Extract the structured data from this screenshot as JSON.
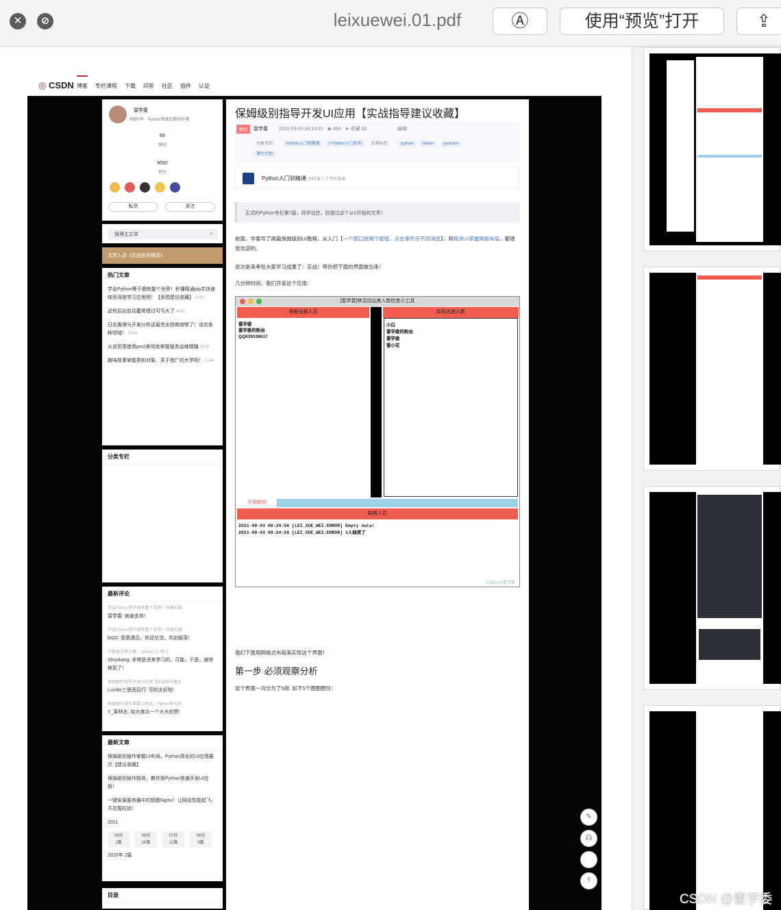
{
  "window": {
    "filename": "leixuewei.01.pdf",
    "open_with_preview": "使用“预览”打开",
    "markup_icon": "pen-circle-icon",
    "share_icon": "share-icon"
  },
  "csdn": {
    "logo": "CSDN",
    "nav": [
      "博客",
      "专栏课程",
      "下载",
      "问答",
      "社区",
      "插件",
      "认证"
    ]
  },
  "profile": {
    "name": "雷学委",
    "level": "码龄0年",
    "tag": "Python领域优质创作者",
    "stat1_value": "69",
    "stat1_label": "原创",
    "stat2_value": "9592",
    "stat2_label": "积分",
    "btn_msg": "私信",
    "btn_follow": "关注"
  },
  "search": {
    "placeholder": "搜博主文章"
  },
  "banner": {
    "text": "文章入选《实战指导推荐》"
  },
  "hot": {
    "title": "热门文章",
    "items": [
      {
        "text": "学会Python等于拥有整个世界！秒懂精通pip并快速体验深度学习应用吧！【多图建议收藏】",
        "views": "4781"
      },
      {
        "text": "这些后台启动蓄势错过可亏大了",
        "views": "4061"
      },
      {
        "text": "日志推理与开发分析这篇完全指南就够了！适应各种领域！",
        "views": "3294"
      },
      {
        "text": "从该到落使用pm2来彻底掌握服务运维精髓",
        "views": "3078"
      },
      {
        "text": "趣味故事掌握类和对象，关于我广的大学网！",
        "views": "2144"
      }
    ]
  },
  "categories": {
    "title": "分类专栏"
  },
  "comments": {
    "title": "最新评论",
    "items": [
      {
        "ref": "学会Python等于拥有整个世界！快速优雅",
        "text": "雷学委: 谢谢支持！"
      },
      {
        "ref": "学会Python等于拥有整个世界！快速优雅",
        "text": "bit22: 感恩遇见，欢迎交流，共创部落！"
      },
      {
        "ref": "大数据王者之路：Ambari 01 简介",
        "text": "Shuokang: 非常是进来学习的，可能，干是，被惊艳到了！"
      },
      {
        "ref": "保姆级别指导开发UI应用【实战指导建议",
        "text": "Lucifer三思而后行: 写的太好啦!"
      },
      {
        "ref": "保姆级别操作掌握UI布局，Python简化的",
        "text": "Y_蒋林志: 给大佬点一个大大的赞!"
      }
    ]
  },
  "latest": {
    "title": "最新文章",
    "items": [
      "保姆级别操作掌握UI布局，Python简化的UI应用展示【建议收藏】",
      "保姆级别操作指导，教你用Python快速开发UI应用！",
      "一键安装服务器中的超跑Nginx！让网站性能起飞，不花冤枉钱！"
    ],
    "year1": "2021",
    "months": [
      {
        "m": "09月",
        "c": "2篇"
      },
      {
        "m": "08月",
        "c": "16篇"
      },
      {
        "m": "07月",
        "c": "12篇"
      },
      {
        "m": "06月",
        "c": "9篇"
      }
    ],
    "year2": "2020年  2篇"
  },
  "toc": {
    "title": "目录"
  },
  "article": {
    "title": "保姆级别指导开发UI应用【实战指导建议收藏】",
    "badge": "原创",
    "author": "雷学委",
    "date": "2021-09-03 04:14:31",
    "views": "464",
    "collect": "收藏 62",
    "edit": "编辑",
    "column_label": "分类专栏：",
    "column1": "Python入门到精通",
    "column2": "# Python入门系列",
    "tags_label": "文章标签：",
    "tags": [
      "python",
      "tkinter",
      "pycharm"
    ],
    "plan": "潜力计划",
    "col_name": "Python入门到精通",
    "col_sub": "同时被 2 个专栏收录",
    "quote": "正式的Python专栏第7篇，同学站住，别错过这个从0开始的文章！",
    "p1_a": "前面，学委写了两篇保姆级别UI教程，从入门【",
    "p1_link1": "一个窗口放两个按钮，点击事件示不同消息",
    "p1_b": "】，到",
    "p1_link2": "精讲UI掌握网格布局",
    "p1_c": "，都很受欢迎的。",
    "p2": "这次是来考验大家学习成果了：实战！带你把下面的界面做出来！",
    "p3": "几分钟时间，我们开发这个应用：",
    "p4": "我们下面用网格式布局来实现这个界面！",
    "h2": "第一步 必须观察分析",
    "p5": "这个界面一共分为了5排, 如下5个圈圈圈住："
  },
  "app": {
    "title": "[雷学委]移活动出席人数检查小工具",
    "left_header": "预期全部人员",
    "right_header": "实际出席人数",
    "left_list": [
      "雷学委",
      "雷学委的粉丝",
      "QQ639336617"
    ],
    "right_list": [
      "小白",
      "雷学委的粉丝",
      "雷学委",
      "雷小花"
    ],
    "check_btn": "开始校验",
    "missing": "缺席人员",
    "log": [
      "2021-09-03 08:24:56 [LEI_XUE_WEI:ERROR] Empty data!",
      "2021-09-03 08:24:56 [LEI_XUE_WEI:ERROR] 1人缺席了"
    ],
    "watermark": "CSDN @雷学委"
  },
  "overlay_watermark": "CSDN @雷学委"
}
